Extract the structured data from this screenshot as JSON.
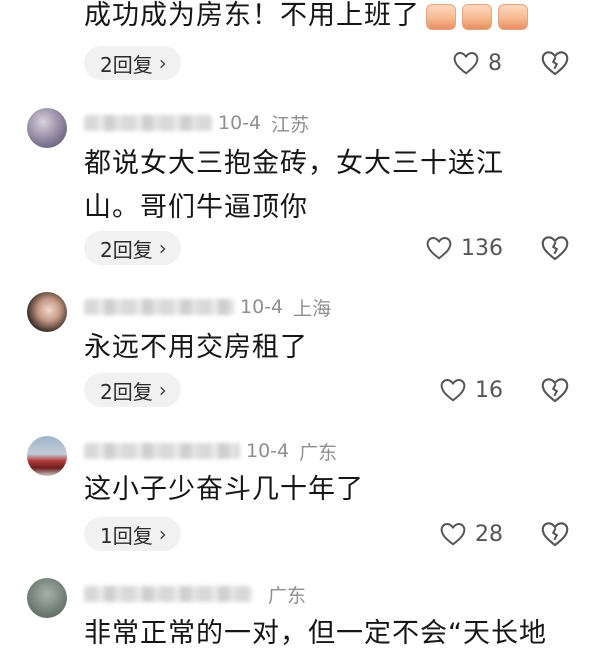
{
  "comments": [
    {
      "text": "成功成为房东！不用上班了",
      "emoji_count": 3,
      "reply_label": "2回复",
      "likes": "8"
    },
    {
      "date": "10-4",
      "location": "江苏",
      "text_line1": "都说女大三抱金砖，女大三十送江",
      "text_line2": "山。哥们牛逼顶你",
      "reply_label": "2回复",
      "likes": "136"
    },
    {
      "date": "10-4",
      "location": "上海",
      "text": "永远不用交房租了",
      "reply_label": "2回复",
      "likes": "16"
    },
    {
      "date": "10-4",
      "location": "广东",
      "text": "这小子少奋斗几十年了",
      "reply_label": "1回复",
      "likes": "28"
    },
    {
      "date": "",
      "location": "广东",
      "text": "非常正常的一对，但一定不会“天长地"
    }
  ],
  "icons": {
    "chevron": "chevron-right-icon",
    "like": "heart-outline-icon",
    "dislike": "broken-heart-icon"
  },
  "colors": {
    "reply_bg": "#f1f1f1",
    "meta_text": "#8f8f8f",
    "body_text": "#161616"
  }
}
